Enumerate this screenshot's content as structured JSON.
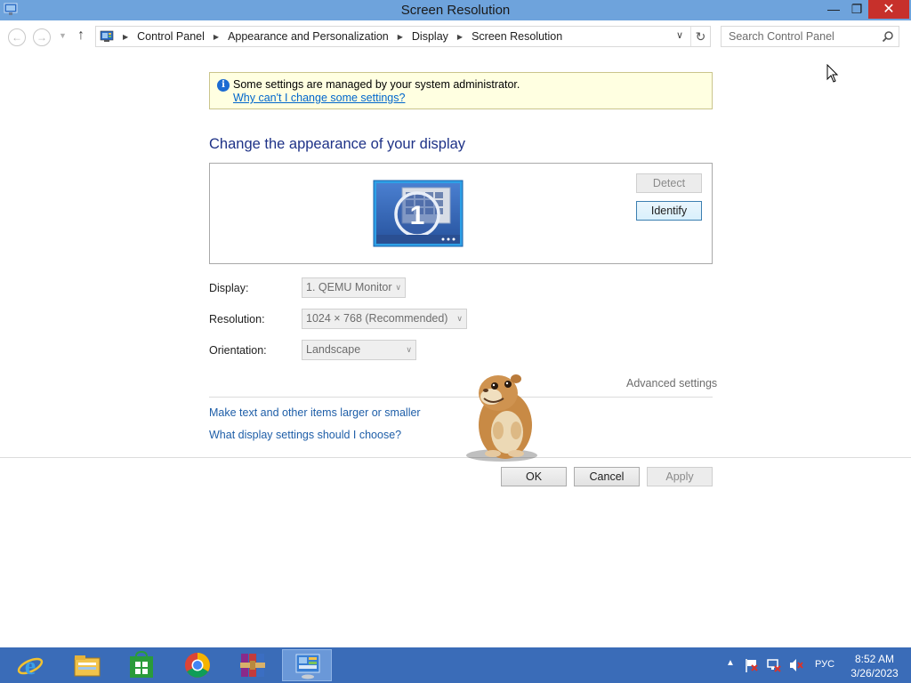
{
  "window": {
    "title": "Screen Resolution",
    "minimize_glyph": "—",
    "maximize_glyph": "❐",
    "close_glyph": "✕"
  },
  "address": {
    "breadcrumbs": [
      "Control Panel",
      "Appearance and Personalization",
      "Display",
      "Screen Resolution"
    ],
    "search_placeholder": "Search Control Panel"
  },
  "info_bar": {
    "message": "Some settings are managed by your system administrator.",
    "link": "Why can't I change some settings?"
  },
  "heading": "Change the appearance of your display",
  "monitor_panel": {
    "monitor_number": "1",
    "detect_label": "Detect",
    "identify_label": "Identify"
  },
  "form": {
    "display_label": "Display:",
    "display_value": "1. QEMU Monitor",
    "resolution_label": "Resolution:",
    "resolution_value": "1024 × 768 (Recommended)",
    "orientation_label": "Orientation:",
    "orientation_value": "Landscape"
  },
  "advanced_settings": "Advanced settings",
  "links": {
    "text_size": "Make text and other items larger or smaller",
    "which_settings": "What display settings should I choose?"
  },
  "dialog_buttons": {
    "ok": "OK",
    "cancel": "Cancel",
    "apply": "Apply"
  },
  "taskbar": {
    "apps": [
      "internet-explorer-icon",
      "file-explorer-icon",
      "windows-store-icon",
      "chrome-icon",
      "winrar-icon",
      "control-panel-icon"
    ],
    "language": "РУС",
    "time": "8:52 AM",
    "date": "3/26/2023"
  },
  "colors": {
    "titlebar": "#6ea3dc",
    "taskbar": "#3a6cb8",
    "heading": "#1e3287",
    "link": "#1e5ea8",
    "infobar_bg": "#ffffe1"
  }
}
